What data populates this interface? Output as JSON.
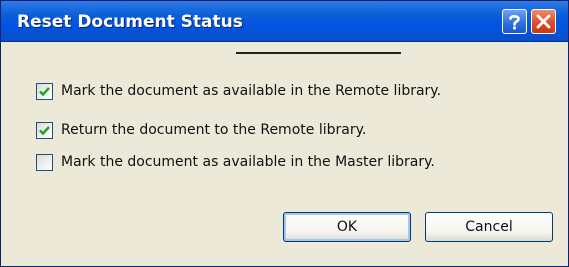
{
  "dialog": {
    "title": "Reset Document Status",
    "help_icon": "question-mark-icon",
    "close_icon": "close-x-icon",
    "colors": {
      "titlebar": "#0054e3",
      "background": "#ece9d8",
      "check": "#21a121",
      "close": "#d94a26"
    }
  },
  "options": [
    {
      "label": "Mark the document as available in the Remote library.",
      "checked": true
    },
    {
      "label": "Return the document to the Remote library.",
      "checked": true
    },
    {
      "label": "Mark the document as available in the Master library.",
      "checked": false
    }
  ],
  "buttons": {
    "ok_label": "OK",
    "cancel_label": "Cancel"
  }
}
